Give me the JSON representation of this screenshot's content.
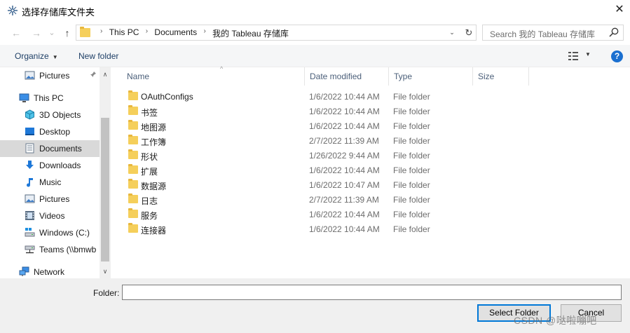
{
  "window": {
    "title": "选择存储库文件夹",
    "close_glyph": "✕"
  },
  "nav": {
    "back_glyph": "←",
    "forward_glyph": "→",
    "dropdown_glyph": "⌄",
    "up_glyph": "↑"
  },
  "address": {
    "crumbs": [
      "This PC",
      "Documents",
      "我的 Tableau 存储库"
    ],
    "sep_glyph": "›",
    "dropdown_glyph": "⌄",
    "refresh_glyph": "↻"
  },
  "search": {
    "placeholder": "Search 我的 Tableau 存储库"
  },
  "toolbar": {
    "organize_label": "Organize",
    "caret_glyph": "▼",
    "new_folder_label": "New folder",
    "help_glyph": "?"
  },
  "sidebar": {
    "items": [
      {
        "label": "Pictures",
        "icon": "pictures-icon"
      },
      {
        "label": "This PC",
        "icon": "computer-icon"
      },
      {
        "label": "3D Objects",
        "icon": "cube-icon"
      },
      {
        "label": "Desktop",
        "icon": "desktop-icon"
      },
      {
        "label": "Documents",
        "icon": "documents-icon"
      },
      {
        "label": "Downloads",
        "icon": "download-icon"
      },
      {
        "label": "Music",
        "icon": "music-icon"
      },
      {
        "label": "Pictures",
        "icon": "pictures-icon"
      },
      {
        "label": "Videos",
        "icon": "video-icon"
      },
      {
        "label": "Windows (C:)",
        "icon": "drive-icon"
      },
      {
        "label": "Teams (\\\\bmwb",
        "icon": "network-drive-icon"
      },
      {
        "label": "Network",
        "icon": "network-icon"
      }
    ],
    "pin_glyph": "📌",
    "scroll_up_glyph": "∧",
    "scroll_down_glyph": "∨",
    "selected_color": "#d9d9d9"
  },
  "columns": {
    "name": "Name",
    "date": "Date modified",
    "type": "Type",
    "size": "Size",
    "sort_glyph": "^"
  },
  "files": [
    {
      "name": "OAuthConfigs",
      "date": "1/6/2022 10:44 AM",
      "type": "File folder"
    },
    {
      "name": "书签",
      "date": "1/6/2022 10:44 AM",
      "type": "File folder"
    },
    {
      "name": "地图源",
      "date": "1/6/2022 10:44 AM",
      "type": "File folder"
    },
    {
      "name": "工作簿",
      "date": "2/7/2022 11:39 AM",
      "type": "File folder"
    },
    {
      "name": "形状",
      "date": "1/26/2022 9:44 AM",
      "type": "File folder"
    },
    {
      "name": "扩展",
      "date": "1/6/2022 10:44 AM",
      "type": "File folder"
    },
    {
      "name": "数据源",
      "date": "1/6/2022 10:47 AM",
      "type": "File folder"
    },
    {
      "name": "日志",
      "date": "2/7/2022 11:39 AM",
      "type": "File folder"
    },
    {
      "name": "服务",
      "date": "1/6/2022 10:44 AM",
      "type": "File folder"
    },
    {
      "name": "连接器",
      "date": "1/6/2022 10:44 AM",
      "type": "File folder"
    }
  ],
  "footer": {
    "folder_label": "Folder:",
    "folder_value": "",
    "select_label": "Select Folder",
    "cancel_label": "Cancel",
    "watermark": "CSDN @哒啦嘣吧"
  },
  "colors": {
    "accent": "#0078d7",
    "folder": "#f5cf5b",
    "help": "#1a6fd0"
  }
}
